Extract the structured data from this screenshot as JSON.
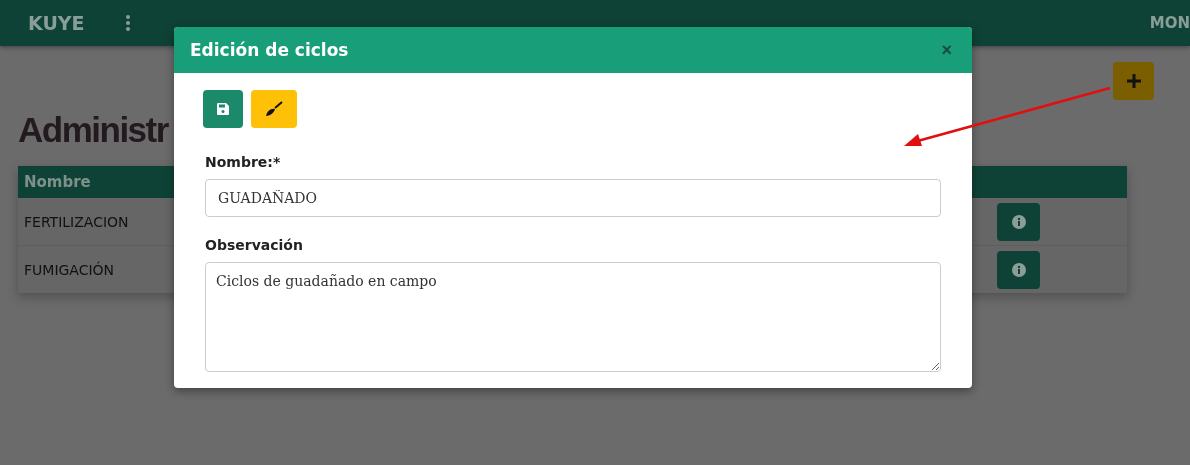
{
  "navbar": {
    "brand": "KUYE",
    "user": "MON"
  },
  "page": {
    "title": "Administr"
  },
  "table": {
    "columns": [
      "Nombre"
    ],
    "rows": [
      {
        "nombre": "FERTILIZACION"
      },
      {
        "nombre": "FUMIGACIÓN"
      }
    ]
  },
  "modal": {
    "title": "Edición de ciclos",
    "close": "×",
    "fields": [
      {
        "kind": "input",
        "label": "Nombre:*",
        "value": "GUADAÑADO"
      },
      {
        "kind": "textarea",
        "label": "Observación",
        "value": "Ciclos de guadañado en campo"
      }
    ]
  }
}
